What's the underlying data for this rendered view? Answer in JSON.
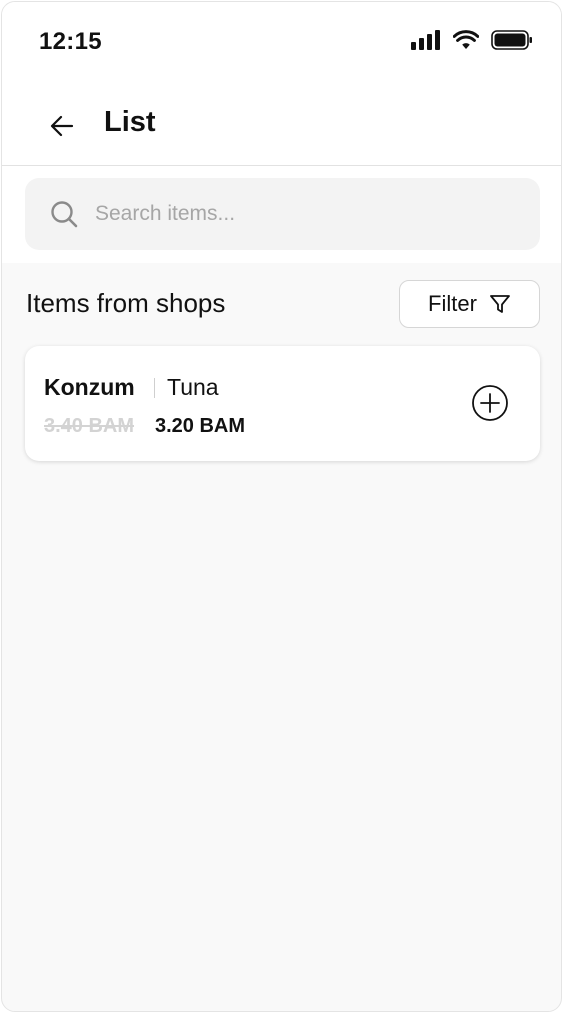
{
  "status_bar": {
    "time": "12:15",
    "icons": [
      "cellular-signal-icon",
      "wifi-icon",
      "battery-icon"
    ]
  },
  "header": {
    "back_icon": "arrow-left-icon",
    "title": "List"
  },
  "search": {
    "placeholder": "Search items...",
    "value": "",
    "icon": "search-icon"
  },
  "section": {
    "title": "Items from shops",
    "filter_label": "Filter",
    "filter_icon": "funnel-icon"
  },
  "items": [
    {
      "shop": "Konzum",
      "name": "Tuna",
      "old_price": "3.40 BAM",
      "new_price": "3.20 BAM",
      "action_icon": "plus-circle-icon"
    }
  ],
  "colors": {
    "background": "#f9f9f9",
    "surface": "#ffffff",
    "search_bg": "#f3f3f3",
    "text": "#111111",
    "muted": "#a6a6a6",
    "strike": "#d3d3d3"
  }
}
